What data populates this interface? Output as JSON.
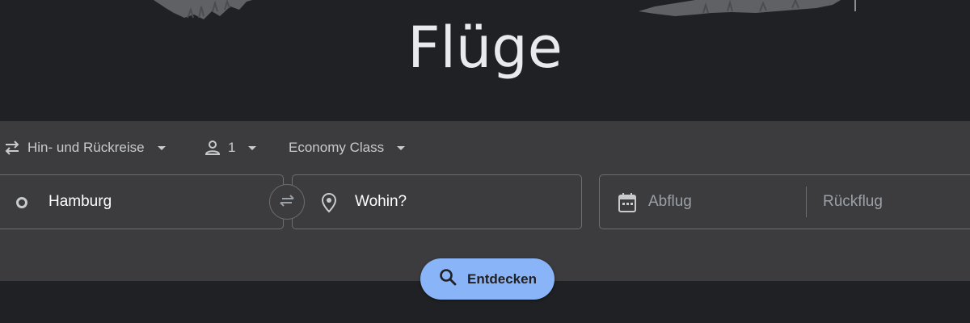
{
  "page": {
    "title": "Flüge"
  },
  "search": {
    "trip_type": "Hin- und Rückreise",
    "passengers": "1",
    "cabin_class": "Economy Class",
    "origin": "Hamburg",
    "destination_placeholder": "Wohin?",
    "departure_placeholder": "Abflug",
    "return_placeholder": "Rückflug",
    "explore_label": "Entdecken"
  },
  "colors": {
    "background": "#202124",
    "card": "#3c3c3e",
    "border": "#6c6e72",
    "accent": "#8ab4f8",
    "text": "#e8eaed",
    "muted": "#9aa0a6"
  },
  "icons": {
    "trip_type": "swap-arrows-icon",
    "passengers": "person-icon",
    "origin": "circle-icon",
    "swap": "swap-icon",
    "destination": "location-pin-icon",
    "departure": "calendar-icon",
    "explore": "search-icon"
  }
}
